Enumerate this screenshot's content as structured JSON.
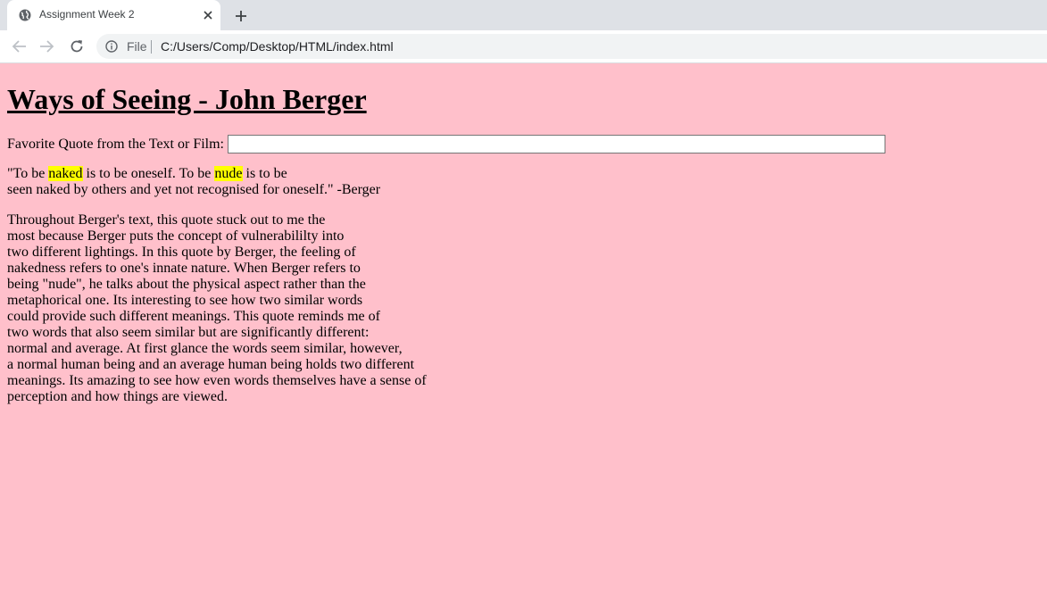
{
  "browser": {
    "tab_title": "Assignment Week 2",
    "omnibox_scheme": "File",
    "omnibox_url": "C:/Users/Comp/Desktop/HTML/index.html"
  },
  "page": {
    "heading": "Ways of Seeing - John Berger",
    "quote_label": "Favorite Quote from the Text or Film:",
    "quote_input_value": "",
    "quote": {
      "line1_a": "\"To be ",
      "line1_hl1": "naked",
      "line1_b": " is to be oneself. To be ",
      "line1_hl2": "nude",
      "line1_c": " is to be",
      "line2": "seen naked by others and yet not recognised for oneself.\" -Berger"
    },
    "essay_lines": [
      "Throughout Berger's text, this quote stuck out to me the",
      "most because Berger puts the concept of vulnerabililty into",
      "two different lightings. In this quote by Berger, the feeling of",
      "nakedness refers to one's innate nature. When Berger refers to",
      "being \"nude\", he talks about the physical aspect rather than the",
      "metaphorical one. Its interesting to see how two similar words",
      "could provide such different meanings. This quote reminds me of",
      "two words that also seem similar but are significantly different:",
      "normal and average. At first glance the words seem similar, however,",
      "a normal human being and an average human being holds two different",
      "meanings. Its amazing to see how even words themselves have a sense of",
      "perception and how things are viewed."
    ]
  },
  "colors": {
    "page_background": "#ffc0cb",
    "highlight": "#ffff00"
  }
}
